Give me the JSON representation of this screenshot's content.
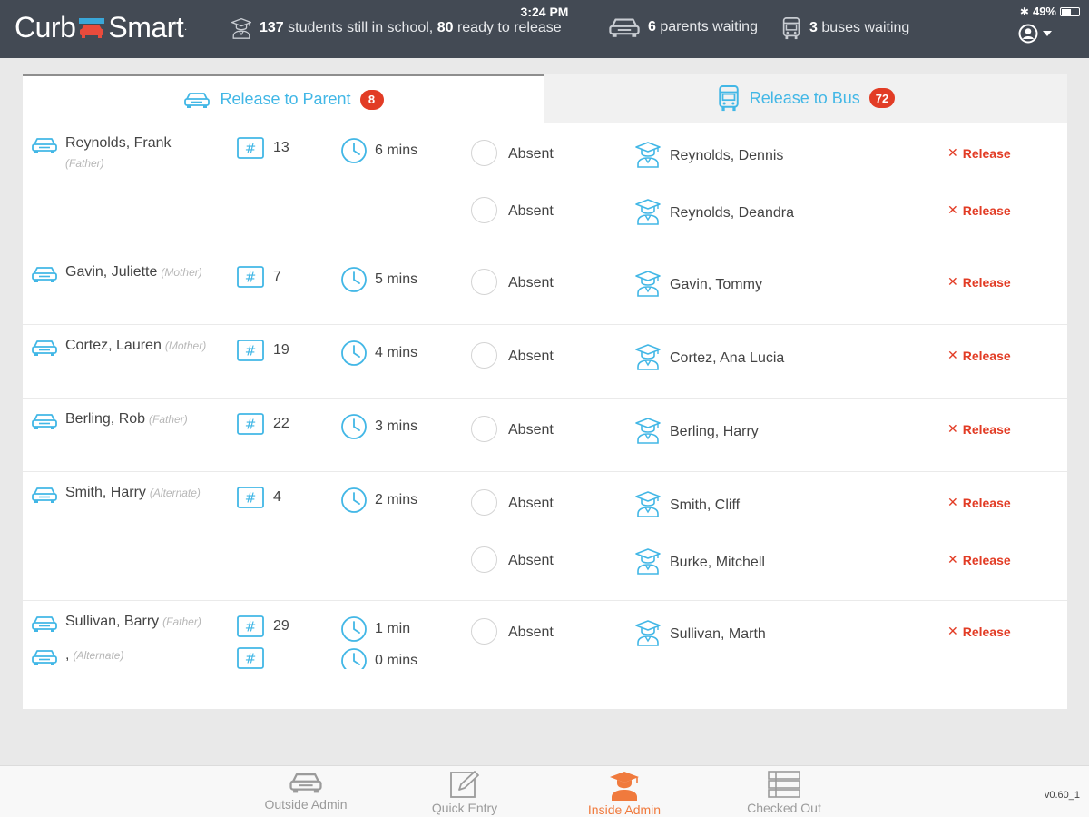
{
  "header": {
    "logo_left": "Curb",
    "logo_right": "Smart",
    "logo_reg": ".",
    "time": "3:24 PM",
    "battery": "49%",
    "students_count": "137",
    "students_text": "students still in school,",
    "ready_count": "80",
    "ready_text": "ready to release",
    "parents_count": "6",
    "parents_text": "parents waiting",
    "buses_count": "3",
    "buses_text": "buses waiting"
  },
  "tabs": {
    "parent_label": "Release to Parent",
    "parent_badge": "8",
    "bus_label": "Release to Bus",
    "bus_badge": "72"
  },
  "labels": {
    "absent": "Absent",
    "release": "Release"
  },
  "rows": [
    {
      "parent": "Reynolds, Frank",
      "relation": "(Father)",
      "number": "13",
      "wait": "6 mins",
      "students": [
        "Reynolds, Dennis",
        "Reynolds, Deandra"
      ]
    },
    {
      "parent": "Gavin, Juliette",
      "relation": "(Mother)",
      "number": "7",
      "wait": "5 mins",
      "students": [
        "Gavin, Tommy"
      ]
    },
    {
      "parent": "Cortez, Lauren",
      "relation": "(Mother)",
      "number": "19",
      "wait": "4 mins",
      "students": [
        "Cortez, Ana Lucia"
      ]
    },
    {
      "parent": "Berling, Rob",
      "relation": "(Father)",
      "number": "22",
      "wait": "3 mins",
      "students": [
        "Berling, Harry"
      ]
    },
    {
      "parent": "Smith, Harry",
      "relation": "(Alternate)",
      "number": "4",
      "wait": "2 mins",
      "students": [
        "Smith, Cliff",
        "Burke, Mitchell"
      ]
    },
    {
      "parent": "Sullivan, Barry",
      "relation": "(Father)",
      "number": "29",
      "wait": "1 min",
      "students": [
        "Sullivan, Marth"
      ]
    }
  ],
  "partial_row": {
    "parent": ",",
    "relation": "(Alternate)",
    "number": "",
    "wait": "0 mins"
  },
  "bottom_nav": {
    "outside_admin": "Outside Admin",
    "quick_entry": "Quick Entry",
    "inside_admin": "Inside Admin",
    "checked_out": "Checked Out"
  },
  "version": "v0.60_1",
  "colors": {
    "header_bg": "#434a54",
    "accent_blue": "#42b7e6",
    "badge_red": "#e23c25",
    "active_orange": "#f07a3d"
  }
}
